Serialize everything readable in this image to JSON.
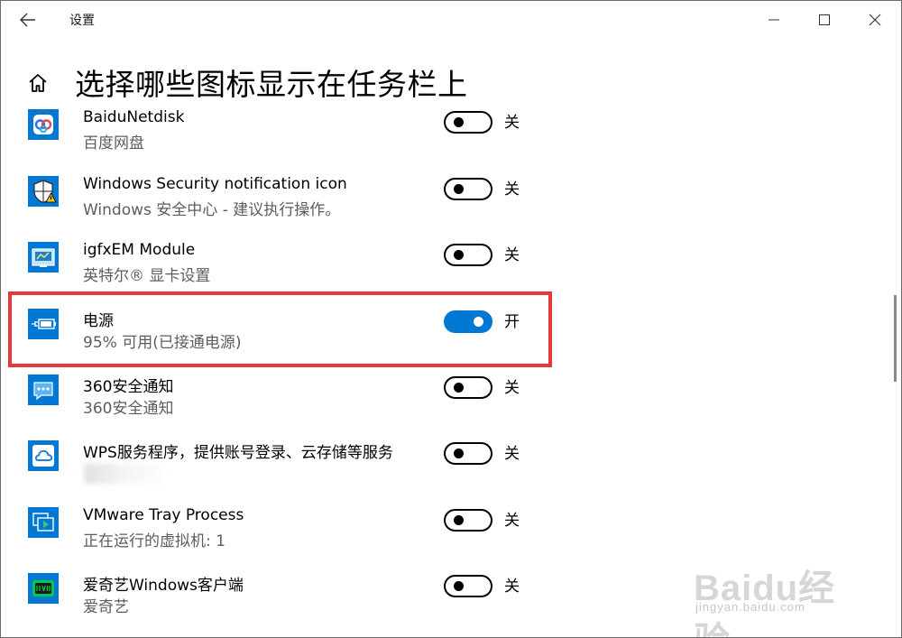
{
  "window": {
    "title": "设置",
    "controls": {
      "minimize_icon": "minimize-icon",
      "maximize_icon": "maximize-icon",
      "close_icon": "close-icon"
    }
  },
  "page": {
    "title": "选择哪些图标显示在任务栏上"
  },
  "apps": [
    {
      "name": "BaiduNetdisk",
      "subtitle": "百度网盘",
      "state": "关",
      "on": false,
      "icon": "baidu-netdisk-icon"
    },
    {
      "name": "Windows Security notification icon",
      "subtitle": "Windows 安全中心 - 建议执行操作。",
      "state": "关",
      "on": false,
      "icon": "shield-warning-icon"
    },
    {
      "name": "igfxEM Module",
      "subtitle": "英特尔® 显卡设置",
      "state": "关",
      "on": false,
      "icon": "intel-graphics-icon"
    },
    {
      "name": "电源",
      "subtitle": "95% 可用(已接通电源)",
      "state": "开",
      "on": true,
      "icon": "battery-plug-icon"
    },
    {
      "name": "360安全通知",
      "subtitle": "360安全通知",
      "state": "关",
      "on": false,
      "icon": "chat-bubble-icon"
    },
    {
      "name": "WPS服务程序，提供账号登录、云存储等服务",
      "subtitle": "",
      "state": "关",
      "on": false,
      "icon": "cloud-icon"
    },
    {
      "name": "VMware Tray Process",
      "subtitle": "正在运行的虚拟机: 1",
      "state": "关",
      "on": false,
      "icon": "vmware-icon"
    },
    {
      "name": "爱奇艺Windows客户端",
      "subtitle": "爱奇艺",
      "state": "关",
      "on": false,
      "icon": "iqiyi-icon"
    }
  ],
  "watermark": {
    "brand": "Baidu经验",
    "url": "jingyan.baidu.com"
  },
  "colors": {
    "accent": "#0078d4",
    "icon_bg": "#0078d4",
    "highlight": "#e8373b"
  }
}
